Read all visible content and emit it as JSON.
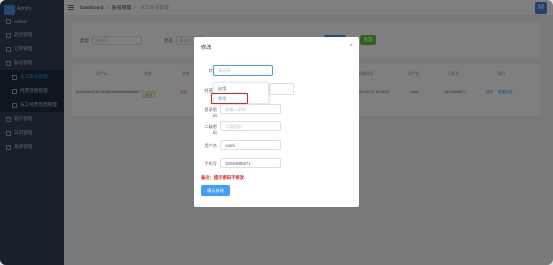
{
  "sidebar": {
    "logo_text": "Admin",
    "items": [
      {
        "label": "Admin",
        "type": "top"
      },
      {
        "label": "后台管理",
        "type": "top"
      },
      {
        "label": "订单管理",
        "type": "top"
      },
      {
        "label": "账号管理",
        "type": "top"
      },
      {
        "label": "员工账号管理",
        "type": "sub",
        "active": true
      },
      {
        "label": "经营范围管理",
        "type": "sub"
      },
      {
        "label": "员工经营范围管理",
        "type": "sub"
      },
      {
        "label": "客户管理",
        "type": "top"
      },
      {
        "label": "日志管理",
        "type": "top"
      },
      {
        "label": "系统管理",
        "type": "top"
      }
    ]
  },
  "header": {
    "crumbs": [
      "Dashboard",
      "账号管理",
      "员工账号管理"
    ],
    "avatar_letter": "M"
  },
  "filter": {
    "type_label": "类型",
    "type_placeholder": "请选择",
    "status_label": "状态",
    "status_placeholder": "请选择",
    "search_label": "搜索",
    "reset_label": "重置"
  },
  "table": {
    "headers": [
      "用户ID",
      "状态",
      "状态",
      "",
      "",
      "创建时间",
      "用户名",
      "手机号",
      "操作"
    ],
    "row": {
      "user_id": "8c09985e5791493d82e8a9e6a8bd60b7",
      "status_tag": "启用",
      "status2": "启用",
      "created": "2024-06-22 16:02:59",
      "username": "cashi",
      "phone": "18349665671",
      "actions": [
        "修改",
        "重置密码"
      ]
    }
  },
  "dialog": {
    "title": "修改",
    "close_icon": "close-icon",
    "status_label": "状态",
    "status_placeholder": "请选择",
    "options": [
      "启用",
      "禁用"
    ],
    "highlighted_option": "禁用",
    "scope_label": "经营范围",
    "scope_placeholder": "请选择",
    "first_pwd_label": "登录密码",
    "first_pwd_placeholder": "请输入密码",
    "second_pwd_label": "二级密码",
    "second_pwd_placeholder": "二级密码",
    "username_label": "用户名",
    "username_value": "cashi",
    "phone_label": "手机号",
    "phone_value": "18349665671",
    "note": "备注：提示密码不修改",
    "submit_label": "确认修改"
  },
  "colors": {
    "primary": "#409eff",
    "success": "#67c23a",
    "danger": "#e02020",
    "sidebar_bg": "#304156"
  }
}
